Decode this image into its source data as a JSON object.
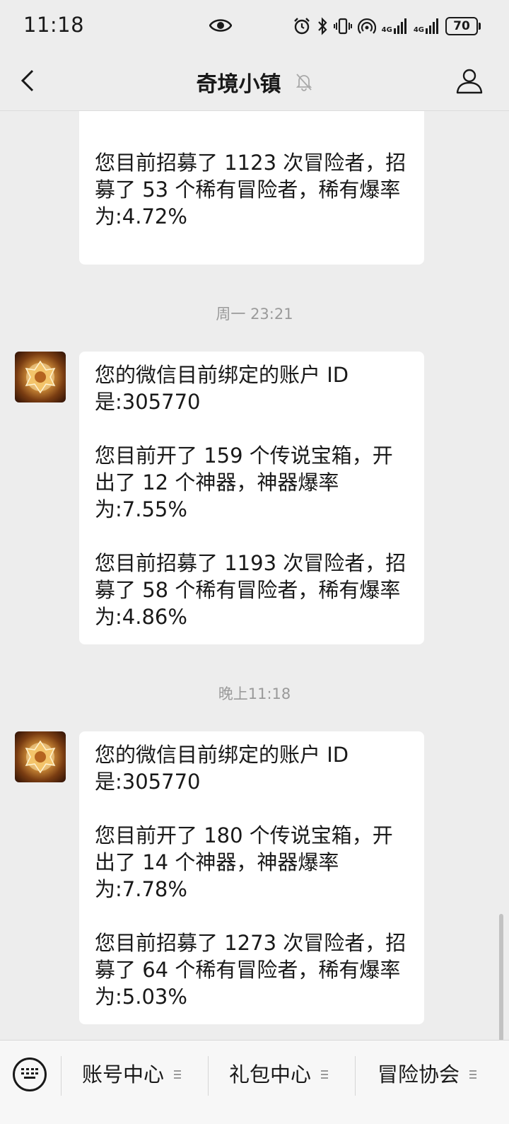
{
  "status_bar": {
    "time": "11:18",
    "net1": "4G",
    "net2": "4G",
    "battery": "70"
  },
  "header": {
    "title": "奇境小镇"
  },
  "messages": [
    {
      "paragraphs": [
        "您目前招募了 1123 次冒险者，招募了 53 个稀有冒险者，稀有爆率为:4.72%"
      ]
    },
    {
      "timestamp": "周一 23:21",
      "paragraphs": [
        "您的微信目前绑定的账户 ID 是:305770",
        "您目前开了 159 个传说宝箱，开出了 12 个神器，神器爆率为:7.55%",
        "您目前招募了 1193 次冒险者，招募了 58 个稀有冒险者，稀有爆率为:4.86%"
      ]
    },
    {
      "timestamp": "晚上11:18",
      "paragraphs": [
        "您的微信目前绑定的账户 ID 是:305770",
        "您目前开了 180 个传说宝箱，开出了 14 个神器，神器爆率为:7.78%",
        "您目前招募了 1273 次冒险者，招募了 64 个稀有冒险者，稀有爆率为:5.03%"
      ]
    }
  ],
  "bottom_menu": {
    "items": [
      "账号中心",
      "礼包中心",
      "冒险协会"
    ]
  },
  "colors": {
    "background": "#ededed",
    "bubble": "#ffffff",
    "timestamp": "#9a9a9a"
  }
}
